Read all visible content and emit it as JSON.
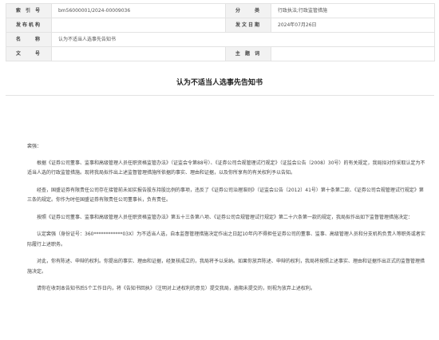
{
  "meta": {
    "index_label": "索 引 号",
    "index_value": "bm56000001/2024-00009036",
    "category_label": "分　　类",
    "category_value": "行政执法;行政监管措施",
    "issuer_label": "发布机构",
    "issuer_value": "",
    "date_label": "发文日期",
    "date_value": "2024年07月26日",
    "name_label": "名　　称",
    "name_value": "认为不适当人选事先告知书",
    "docno_label": "文　　号",
    "docno_value": "",
    "subject_label": "主 题 词",
    "subject_value": ""
  },
  "title": "认为不适当人选事先告知书",
  "body": {
    "salutation": "裴强：",
    "p1": "根据《证券公司董事、监事和高级管理人员任职资格监管办法》（证监会令第88号）、《证券公司合规管理试行规定》（证监会公告〔2008〕30号）的有关规定，我局拟对你采取认定为不适当人选的行政监管措施。现将我局拟作出上述监督管理措施所依据的事实、理由和证据，以及你所享有的有关权利予以告知。",
    "p2": "经查，国盛证券有限责任公司存在接管前未如实报告股东持股比例的事项，违反了《证券公司治理准则》（证监会公告〔2012〕41号）第十条第二款、《证券公司合规管理试行规定》第三条的规定。你作为时任国盛证券有限责任公司董事长，负有责任。",
    "p3": "按照《证券公司董事、监事和高级管理人员任职资格监管办法》第五十三条第八项、《证券公司合规管理试行规定》第二十六条第一款的规定，我局拟作出如下监督管理措施决定：",
    "p4": "认定裴强（身份证号：360************03X）为不适当人选，自本监督管理措施决定作出之日起10年内不得担任证券公司的董事、监事、高级管理人员和分支机构负责人等职务或者实际履行上述职务。",
    "p5": "对此，你有陈述、申辩的权利。你提出的事实、理由和证据，经复核成立的，我局将予以采纳。如果你放弃陈述、申辩的权利，我局将按照上述事实、理由和证据作出正式的监督管理措施决定。",
    "p6": "请你在收到本告知书后5个工作日内，将《告知书回执》（注明对上述权利的意见）提交我局，逾期未提交的，则视为放弃上述权利。"
  }
}
